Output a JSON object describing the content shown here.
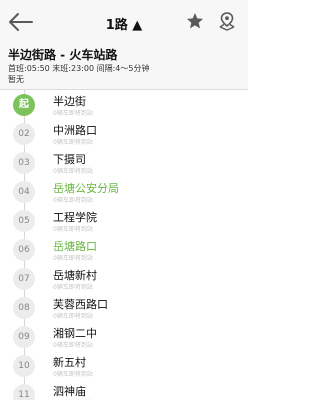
{
  "nav": {
    "title": "1路",
    "direction_symbol": "▲",
    "back_icon": "arrow-left-icon",
    "favorite_icon": "star-icon",
    "map_icon": "map-pin-icon"
  },
  "route": {
    "name": "半边街路 - 火车站路",
    "times": "首班:05:50 末班:23:00  间隔:4～5分钟",
    "status": "暂无"
  },
  "stops": [
    {
      "badge": "起",
      "name": "半边街",
      "sub": "0辆车即将到站",
      "highlight": false,
      "start": true
    },
    {
      "badge": "02",
      "name": "中洲路口",
      "sub": "0辆车即将到站",
      "highlight": false,
      "start": false
    },
    {
      "badge": "03",
      "name": "下摄司",
      "sub": "0辆车即将到站",
      "highlight": false,
      "start": false
    },
    {
      "badge": "04",
      "name": "岳塘公安分局",
      "sub": "0辆车即将到站",
      "highlight": true,
      "start": false
    },
    {
      "badge": "05",
      "name": "工程学院",
      "sub": "0辆车即将到站",
      "highlight": false,
      "start": false
    },
    {
      "badge": "06",
      "name": "岳塘路口",
      "sub": "0辆车即将到站",
      "highlight": true,
      "start": false
    },
    {
      "badge": "07",
      "name": "岳塘新村",
      "sub": "0辆车即将到站",
      "highlight": false,
      "start": false
    },
    {
      "badge": "08",
      "name": "芙蓉西路口",
      "sub": "0辆车即将到站",
      "highlight": false,
      "start": false
    },
    {
      "badge": "09",
      "name": "湘钢二中",
      "sub": "0辆车即将到站",
      "highlight": false,
      "start": false
    },
    {
      "badge": "10",
      "name": "新五村",
      "sub": "0辆车即将到站",
      "highlight": false,
      "start": false
    },
    {
      "badge": "11",
      "name": "泗神庙",
      "sub": "0辆车即将到站",
      "highlight": false,
      "start": false
    }
  ],
  "colors": {
    "accent": "#68b741",
    "start_badge": "#7dc35b",
    "icon": "#5a5a5a"
  }
}
